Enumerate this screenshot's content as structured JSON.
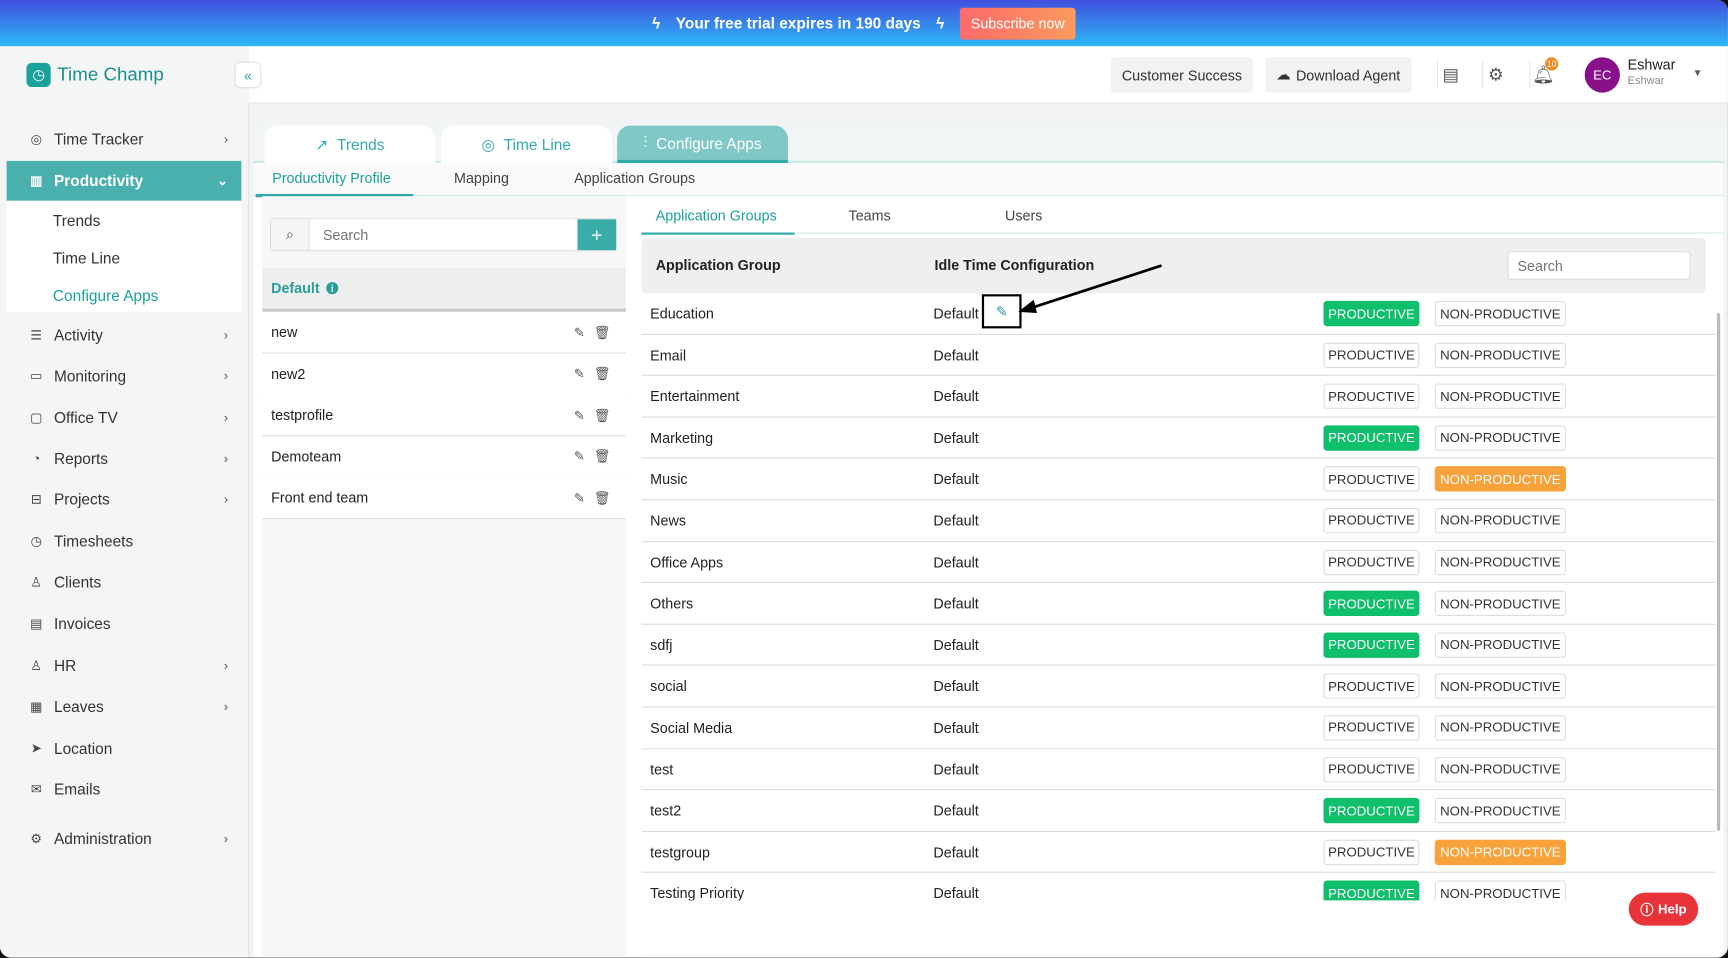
{
  "banner": {
    "message": "Your free trial expires in 190 days",
    "subscribe_label": "Subscribe now"
  },
  "brand": {
    "name": "Time Champ"
  },
  "header": {
    "customer_success": "Customer Success",
    "download_agent": "Download Agent",
    "notification_count": "10",
    "user": {
      "initials": "EC",
      "name": "Eshwar",
      "sub": "Eshwar"
    }
  },
  "sidebar": {
    "items": [
      {
        "label": "Time Tracker",
        "icon": "stopwatch-icon",
        "chev": "›"
      },
      {
        "label": "Productivity",
        "icon": "bar-chart-icon",
        "chev": "⌄"
      },
      {
        "label": "Activity",
        "icon": "activity-icon",
        "chev": "›"
      },
      {
        "label": "Monitoring",
        "icon": "monitor-icon",
        "chev": "›"
      },
      {
        "label": "Office TV",
        "icon": "tv-icon",
        "chev": "›"
      },
      {
        "label": "Reports",
        "icon": "pie-chart-icon",
        "chev": "›"
      },
      {
        "label": "Projects",
        "icon": "briefcase-icon",
        "chev": "›"
      },
      {
        "label": "Timesheets",
        "icon": "clock-icon",
        "chev": ""
      },
      {
        "label": "Clients",
        "icon": "person-icon",
        "chev": ""
      },
      {
        "label": "Invoices",
        "icon": "invoice-icon",
        "chev": ""
      },
      {
        "label": "HR",
        "icon": "user-icon",
        "chev": "›"
      },
      {
        "label": "Leaves",
        "icon": "calendar-icon",
        "chev": "›"
      },
      {
        "label": "Location",
        "icon": "location-arrow-icon",
        "chev": ""
      },
      {
        "label": "Emails",
        "icon": "mail-icon",
        "chev": ""
      },
      {
        "label": "Administration",
        "icon": "gear-icon",
        "chev": "›"
      }
    ],
    "sub_items": [
      "Trends",
      "Time Line",
      "Configure Apps"
    ]
  },
  "tabs": [
    "Trends",
    "Time Line",
    "Configure Apps"
  ],
  "subtabs": [
    "Productivity Profile",
    "Mapping",
    "Application Groups"
  ],
  "profiles": {
    "search_placeholder": "Search",
    "default_label": "Default",
    "items": [
      "new",
      "new2",
      "testprofile",
      "Demoteam",
      "Front end team"
    ]
  },
  "right_tabs": [
    "Application Groups",
    "Teams",
    "Users"
  ],
  "table": {
    "col_group": "Application Group",
    "col_idle": "Idle Time Configuration",
    "search_placeholder": "Search",
    "productive_label": "PRODUCTIVE",
    "non_productive_label": "NON-PRODUCTIVE",
    "rows": [
      {
        "name": "Education",
        "idle": "Default",
        "status": "productive"
      },
      {
        "name": "Email",
        "idle": "Default",
        "status": "none"
      },
      {
        "name": "Entertainment",
        "idle": "Default",
        "status": "none"
      },
      {
        "name": "Marketing",
        "idle": "Default",
        "status": "productive"
      },
      {
        "name": "Music",
        "idle": "Default",
        "status": "non-productive"
      },
      {
        "name": "News",
        "idle": "Default",
        "status": "none"
      },
      {
        "name": "Office Apps",
        "idle": "Default",
        "status": "none"
      },
      {
        "name": "Others",
        "idle": "Default",
        "status": "productive"
      },
      {
        "name": "sdfj",
        "idle": "Default",
        "status": "productive"
      },
      {
        "name": "social",
        "idle": "Default",
        "status": "none"
      },
      {
        "name": "Social Media",
        "idle": "Default",
        "status": "none"
      },
      {
        "name": "test",
        "idle": "Default",
        "status": "none"
      },
      {
        "name": "test2",
        "idle": "Default",
        "status": "productive"
      },
      {
        "name": "testgroup",
        "idle": "Default",
        "status": "non-productive"
      },
      {
        "name": "Testing Priority",
        "idle": "Default",
        "status": "productive"
      }
    ]
  },
  "help_label": "Help",
  "colors": {
    "accent": "#4ab0ad",
    "productive": "#0fbf6b",
    "non_productive": "#f7a23a",
    "avatar": "#8a0f8a"
  }
}
